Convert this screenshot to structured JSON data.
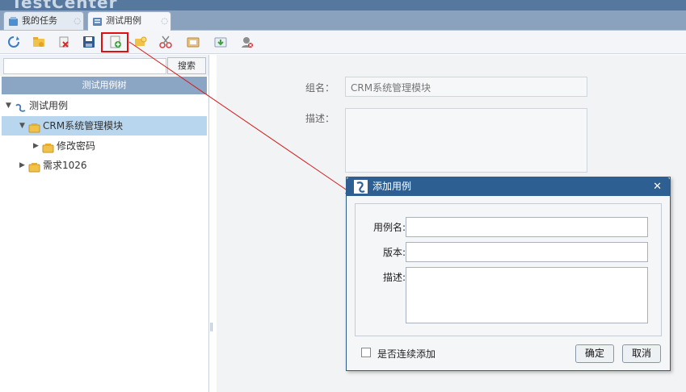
{
  "brand": {
    "text": "TestCenter"
  },
  "tabs": [
    {
      "label": "我的任务",
      "icon": "task-icon"
    },
    {
      "label": "测试用例",
      "icon": "testcase-icon"
    }
  ],
  "toolbar": {
    "buttons": [
      {
        "name": "refresh-button",
        "icon": "refresh-icon"
      },
      {
        "name": "add-group-button",
        "icon": "add-folder-icon"
      },
      {
        "name": "delete-button",
        "icon": "delete-icon"
      },
      {
        "name": "save-button",
        "icon": "save-icon"
      },
      {
        "name": "add-case-button",
        "icon": "add-case-icon"
      },
      {
        "name": "add-child-button",
        "icon": "add-child-icon"
      },
      {
        "name": "cut-button",
        "icon": "scissors-icon"
      },
      {
        "name": "paste-button",
        "icon": "paste-icon"
      },
      {
        "name": "import-button",
        "icon": "import-icon"
      },
      {
        "name": "permission-button",
        "icon": "permission-icon"
      }
    ]
  },
  "left_panel": {
    "search_button": "搜索",
    "tree_header": "测试用例树",
    "tree": [
      {
        "label": "测试用例",
        "level": 0,
        "expanded": true,
        "has_icon": false
      },
      {
        "label": "CRM系统管理模块",
        "level": 1,
        "expanded": true,
        "has_icon": true,
        "selected": true
      },
      {
        "label": "修改密码",
        "level": 2,
        "expanded": false,
        "has_icon": true
      },
      {
        "label": "需求1026",
        "level": 1,
        "expanded": false,
        "has_icon": true
      }
    ]
  },
  "detail": {
    "name_label": "组名：",
    "name_value": "CRM系统管理模块",
    "desc_label": "描述："
  },
  "dialog": {
    "title": "添加用例",
    "close": "✕",
    "fields": {
      "case_name_label": "用例名:",
      "version_label": "版本:",
      "desc_label": "描述:"
    },
    "continuous_label": "是否连续添加",
    "ok_label": "确定",
    "cancel_label": "取消"
  },
  "colors": {
    "header_bg": "#56789f",
    "tree_selected": "#b9d6ef",
    "dialog_title": "#2e5f92",
    "highlight_red": "#e01010"
  }
}
